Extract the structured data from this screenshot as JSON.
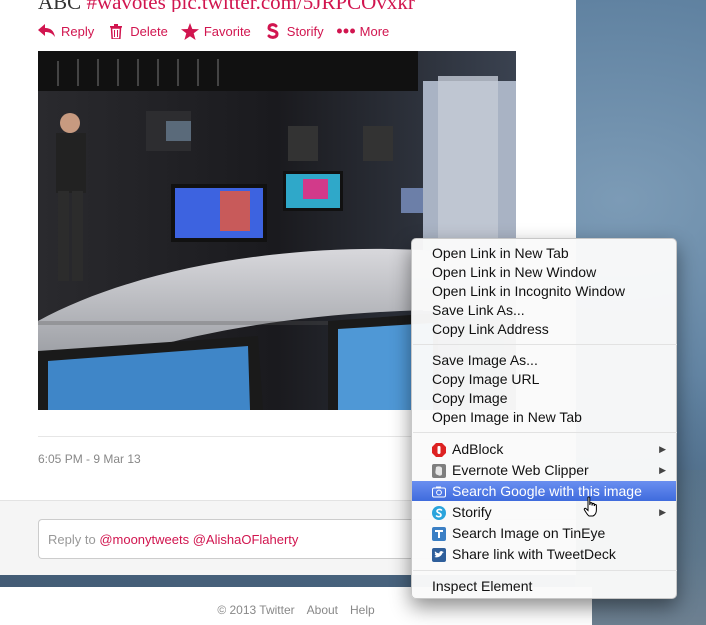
{
  "tweet": {
    "author_fragment": "ABC",
    "hashtag_fragment": "#wavotes pic.twitter.com/5JRPCOvxkr",
    "timestamp": "6:05 PM - 9 Mar 13"
  },
  "actions": [
    {
      "label": "Reply",
      "icon": "reply-icon"
    },
    {
      "label": "Delete",
      "icon": "trash-icon"
    },
    {
      "label": "Favorite",
      "icon": "star-icon"
    },
    {
      "label": "Storify",
      "icon": "storify-icon"
    },
    {
      "label": "More",
      "icon": "more-icon"
    }
  ],
  "reply": {
    "prefix": "Reply to ",
    "mention1": "@moonytweets",
    "mention2": "@AlishaOFlaherty"
  },
  "footer": {
    "copyright": "© 2013 Twitter",
    "about": "About",
    "help": "Help"
  },
  "context_menu": {
    "items": [
      {
        "label": "Open Link in New Tab"
      },
      {
        "label": "Open Link in New Window"
      },
      {
        "label": "Open Link in Incognito Window"
      },
      {
        "label": "Save Link As..."
      },
      {
        "label": "Copy Link Address"
      },
      {
        "label": "Save Image As..."
      },
      {
        "label": "Copy Image URL"
      },
      {
        "label": "Copy Image"
      },
      {
        "label": "Open Image in New Tab"
      },
      {
        "label": "AdBlock",
        "icon": "adblock-icon",
        "submenu": true
      },
      {
        "label": "Evernote Web Clipper",
        "icon": "evernote-icon",
        "submenu": true
      },
      {
        "label": "Search Google with this image",
        "icon": "camera-icon",
        "highlighted": true
      },
      {
        "label": "Storify",
        "icon": "storify-icon",
        "submenu": true
      },
      {
        "label": "Search Image on TinEye",
        "icon": "tineye-icon"
      },
      {
        "label": "Share link with TweetDeck",
        "icon": "tweetdeck-icon"
      },
      {
        "label": "Inspect Element"
      }
    ],
    "submenu_arrow": "▶"
  },
  "colors": {
    "accent": "#d1154f",
    "highlight": "#3f6bdd",
    "text_muted": "#888888"
  }
}
